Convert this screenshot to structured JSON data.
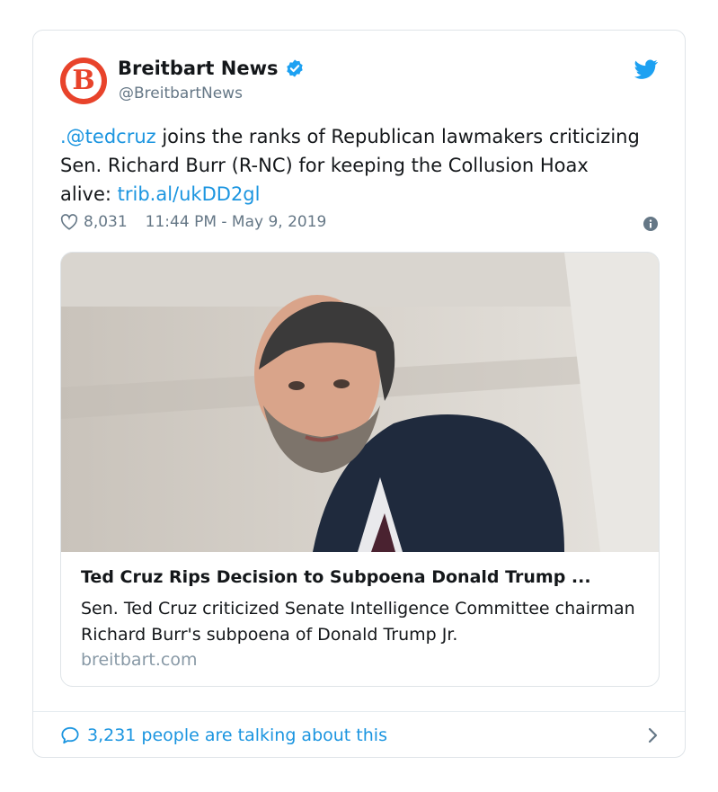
{
  "author": {
    "display_name": "Breitbart News",
    "handle": "@BreitbartNews",
    "avatar_letter": "B",
    "brand_color": "#e8432b",
    "verified": true
  },
  "tweet": {
    "mention": ".@tedcruz",
    "body": " joins the ranks of Republican lawmakers criticizing Sen. Richard Burr (R-NC) for keeping the Collusion Hoax alive: ",
    "link": "trib.al/ukDD2gl"
  },
  "meta": {
    "likes": "8,031",
    "timestamp": "11:44 PM - May 9, 2019"
  },
  "card": {
    "title": "Ted Cruz Rips Decision to Subpoena Donald Trump ...",
    "description": "Sen. Ted Cruz criticized Senate Intelligence Committee chairman Richard Burr's subpoena of Donald Trump Jr.",
    "domain": "breitbart.com"
  },
  "footer": {
    "talking": "3,231 people are talking about this"
  },
  "colors": {
    "link": "#1b95e0",
    "text": "#14171a",
    "muted": "#657786",
    "border": "#dfe4e8"
  },
  "icons": [
    "verified-badge-icon",
    "twitter-bird-icon",
    "heart-icon",
    "info-icon",
    "reply-bubble-icon",
    "chevron-right-icon"
  ]
}
